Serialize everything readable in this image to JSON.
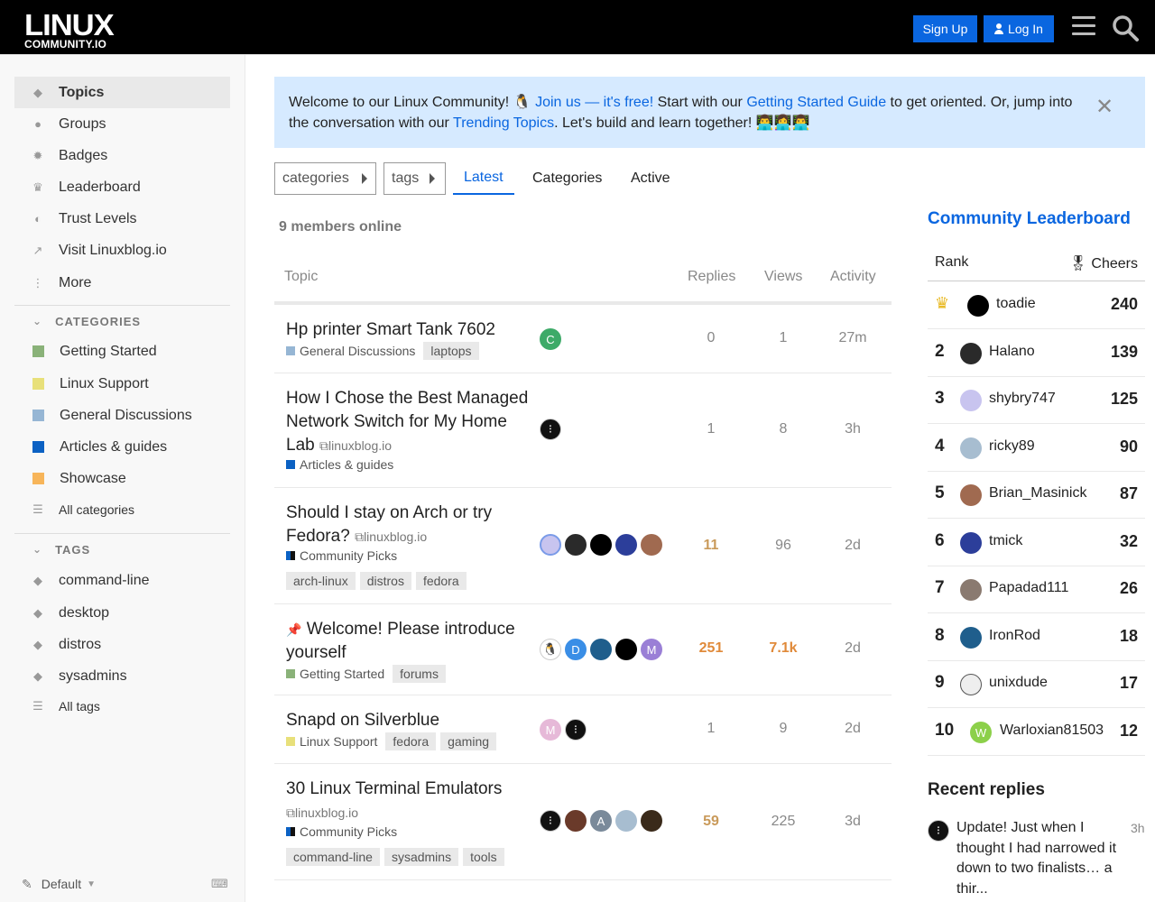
{
  "header": {
    "logo_line1": "LINUX",
    "logo_line2": "COMMUNITY.IO",
    "signup": "Sign Up",
    "login": "Log In"
  },
  "sidebar": {
    "nav": [
      {
        "label": "Topics",
        "icon": "layers-icon"
      },
      {
        "label": "Groups",
        "icon": "users-icon"
      },
      {
        "label": "Badges",
        "icon": "badge-icon"
      },
      {
        "label": "Leaderboard",
        "icon": "crown-icon"
      },
      {
        "label": "Trust Levels",
        "icon": "shield-icon"
      },
      {
        "label": "Visit Linuxblog.io",
        "icon": "external-link-icon"
      },
      {
        "label": "More",
        "icon": "more-vertical-icon"
      }
    ],
    "categories_heading": "CATEGORIES",
    "categories": [
      {
        "label": "Getting Started",
        "color": "#8ab279"
      },
      {
        "label": "Linux Support",
        "color": "#e8e07a"
      },
      {
        "label": "General Discussions",
        "color": "#96b6d4"
      },
      {
        "label": "Articles & guides",
        "color": "#0b61c3"
      },
      {
        "label": "Showcase",
        "color": "#f7b55a"
      }
    ],
    "all_categories": "All categories",
    "tags_heading": "TAGS",
    "tags": [
      "command-line",
      "desktop",
      "distros",
      "sysadmins"
    ],
    "all_tags": "All tags",
    "theme": "Default"
  },
  "banner": {
    "p1": "Welcome to our Linux Community! 🐧 ",
    "l1": "Join us — it's free!",
    "p2": " Start with our ",
    "l2": "Getting Started Guide",
    "p3": " to get oriented. Or, jump into the conversation with our ",
    "l3": "Trending Topics",
    "p4": ". Let's build and learn together! 👨‍💻👩‍💻👨‍💻"
  },
  "filters": {
    "categories": "categories",
    "tags": "tags",
    "tabs": [
      "Latest",
      "Categories",
      "Active"
    ]
  },
  "online": "9 members online",
  "table": {
    "h_topic": "Topic",
    "h_replies": "Replies",
    "h_views": "Views",
    "h_activity": "Activity"
  },
  "topics": [
    {
      "title": "Hp printer Smart Tank 7602",
      "category": "General Discussions",
      "replies": "0",
      "views": "1",
      "activity": "27m",
      "tags": [
        "laptops"
      ]
    },
    {
      "title": "How I Chose the Best Managed Network Switch for My Home Lab",
      "ext": "linuxblog.io",
      "category": "Articles & guides",
      "replies": "1",
      "views": "8",
      "activity": "3h"
    },
    {
      "title": "Should I stay on Arch or try Fedora?",
      "ext": "linuxblog.io",
      "category": "Community Picks",
      "replies": "11",
      "views": "96",
      "activity": "2d",
      "tags": [
        "arch-linux",
        "distros",
        "fedora"
      ]
    },
    {
      "title": "Welcome! Please introduce yourself",
      "category": "Getting Started",
      "replies": "251",
      "views": "7.1k",
      "activity": "2d",
      "tags": [
        "forums"
      ]
    },
    {
      "title": "Snapd on Silverblue",
      "category": "Linux Support",
      "replies": "1",
      "views": "9",
      "activity": "2d",
      "tags": [
        "fedora",
        "gaming"
      ]
    },
    {
      "title": "30 Linux Terminal Emulators",
      "ext": "linuxblog.io",
      "category": "Community Picks",
      "replies": "59",
      "views": "225",
      "activity": "3d",
      "tags": [
        "command-line",
        "sysadmins",
        "tools"
      ]
    }
  ],
  "leaderboard": {
    "title": "Community Leaderboard",
    "h_rank": "Rank",
    "h_cheers": "Cheers",
    "rows": [
      {
        "rank": "",
        "name": "toadie",
        "score": "240"
      },
      {
        "rank": "2",
        "name": "Halano",
        "score": "139"
      },
      {
        "rank": "3",
        "name": "shybry747",
        "score": "125"
      },
      {
        "rank": "4",
        "name": "ricky89",
        "score": "90"
      },
      {
        "rank": "5",
        "name": "Brian_Masinick",
        "score": "87"
      },
      {
        "rank": "6",
        "name": "tmick",
        "score": "32"
      },
      {
        "rank": "7",
        "name": "Papadad111",
        "score": "26"
      },
      {
        "rank": "8",
        "name": "IronRod",
        "score": "18"
      },
      {
        "rank": "9",
        "name": "unixdude",
        "score": "17"
      },
      {
        "rank": "10",
        "name": "Warloxian81503",
        "score": "12"
      }
    ]
  },
  "recent": {
    "title": "Recent replies",
    "text": "Update! Just when I thought I had narrowed it down to two finalists… a thir...",
    "time": "3h"
  },
  "avatars": {
    "c": "C",
    "d": "D",
    "m": "M",
    "a": "A",
    "w": "W"
  }
}
